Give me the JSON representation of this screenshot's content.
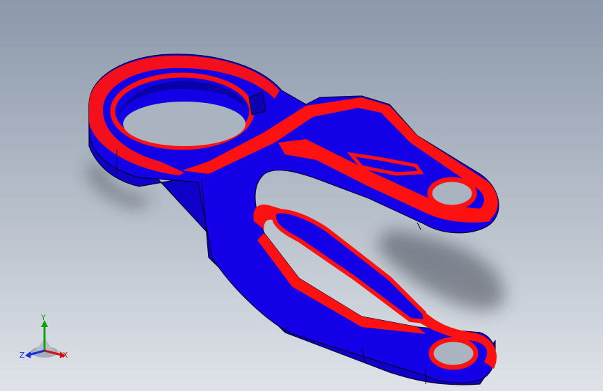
{
  "colors": {
    "background_top": "#8c98ab",
    "background_bottom": "#dfe3e9",
    "part_face": "#1400e6",
    "part_fillet": "#ff1111",
    "edge": "#0a0030",
    "axis_x": "#d01010",
    "axis_y": "#10a010",
    "axis_z": "#1030e0"
  },
  "triad": {
    "x_label": "X",
    "y_label": "Y",
    "z_label": "Z"
  },
  "model": {
    "icon": "cad-part-bracket"
  }
}
